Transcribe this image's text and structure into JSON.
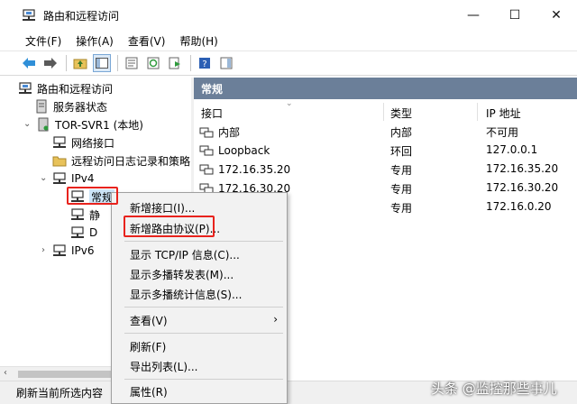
{
  "window": {
    "title": "路由和远程访问",
    "min": "—",
    "max": "☐",
    "close": "✕"
  },
  "menu": [
    "文件(F)",
    "操作(A)",
    "查看(V)",
    "帮助(H)"
  ],
  "tree": {
    "root": "路由和远程访问",
    "server_status": "服务器状态",
    "server": "TOR-SVR1 (本地)",
    "network_interfaces": "网络接口",
    "remote_access_logging": "远程访问日志记录和策略",
    "ipv4": "IPv4",
    "general": "常规",
    "static_partial": "静",
    "dhcp_partial": "D",
    "ipv6": "IPv6"
  },
  "pane": {
    "header": "常规",
    "columns": {
      "interface": "接口",
      "type": "类型",
      "ip": "IP 地址"
    },
    "rows": [
      {
        "interface": "内部",
        "type": "内部",
        "ip": "不可用"
      },
      {
        "interface": "Loopback",
        "type": "环回",
        "ip": "127.0.0.1"
      },
      {
        "interface": "172.16.35.20",
        "type": "专用",
        "ip": "172.16.35.20"
      },
      {
        "interface": "172.16.30.20",
        "type": "专用",
        "ip": "172.16.30.20"
      },
      {
        "interface": "",
        "type": "专用",
        "ip": "172.16.0.20"
      }
    ]
  },
  "context_menu": {
    "new_interface": "新增接口(I)...",
    "new_routing_protocol": "新增路由协议(P)...",
    "show_tcpip": "显示 TCP/IP 信息(C)...",
    "show_multicast_forwarding": "显示多播转发表(M)...",
    "show_multicast_stats": "显示多播统计信息(S)...",
    "view": "查看(V)",
    "refresh": "刷新(F)",
    "export_list": "导出列表(L)...",
    "properties": "属性(R)"
  },
  "status": {
    "text": "刷新当前所选内容"
  },
  "watermark": "头条 @监控那些事儿",
  "colors": {
    "pane_header": "#6b7f99",
    "highlight": "#e8231d",
    "selection": "#cce4f7"
  }
}
